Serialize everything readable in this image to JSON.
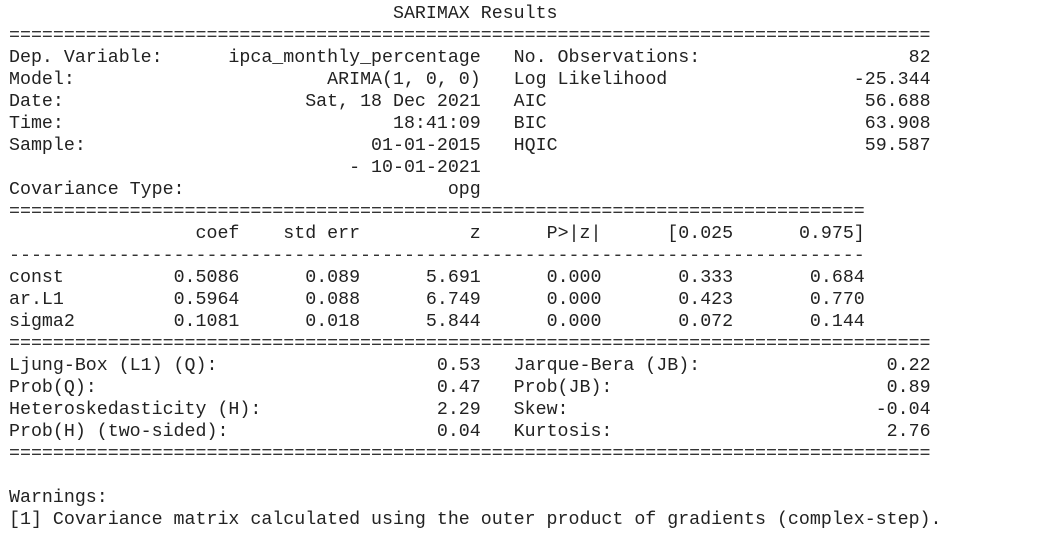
{
  "title": "SARIMAX Results",
  "header": {
    "left": [
      {
        "label": "Dep. Variable:",
        "value": "ipca_monthly_percentage"
      },
      {
        "label": "Model:",
        "value": "ARIMA(1, 0, 0)"
      },
      {
        "label": "Date:",
        "value": "Sat, 18 Dec 2021"
      },
      {
        "label": "Time:",
        "value": "18:41:09"
      },
      {
        "label": "Sample:",
        "value": "01-01-2015"
      },
      {
        "label": "",
        "value": "- 10-01-2021"
      },
      {
        "label": "Covariance Type:",
        "value": "opg"
      }
    ],
    "right": [
      {
        "label": "No. Observations:",
        "value": "82"
      },
      {
        "label": "Log Likelihood",
        "value": "-25.344"
      },
      {
        "label": "AIC",
        "value": "56.688"
      },
      {
        "label": "BIC",
        "value": "63.908"
      },
      {
        "label": "HQIC",
        "value": "59.587"
      }
    ]
  },
  "coef_table": {
    "columns": [
      "coef",
      "std err",
      "z",
      "P>|z|",
      "[0.025",
      "0.975]"
    ],
    "rows": [
      {
        "name": "const",
        "values": [
          "0.5086",
          "0.089",
          "5.691",
          "0.000",
          "0.333",
          "0.684"
        ]
      },
      {
        "name": "ar.L1",
        "values": [
          "0.5964",
          "0.088",
          "6.749",
          "0.000",
          "0.423",
          "0.770"
        ]
      },
      {
        "name": "sigma2",
        "values": [
          "0.1081",
          "0.018",
          "5.844",
          "0.000",
          "0.072",
          "0.144"
        ]
      }
    ]
  },
  "diagnostics": {
    "left": [
      {
        "label": "Ljung-Box (L1) (Q):",
        "value": "0.53"
      },
      {
        "label": "Prob(Q):",
        "value": "0.47"
      },
      {
        "label": "Heteroskedasticity (H):",
        "value": "2.29"
      },
      {
        "label": "Prob(H) (two-sided):",
        "value": "0.04"
      }
    ],
    "right": [
      {
        "label": "Jarque-Bera (JB):",
        "value": "0.22"
      },
      {
        "label": "Prob(JB):",
        "value": "0.89"
      },
      {
        "label": "Skew:",
        "value": "-0.04"
      },
      {
        "label": "Kurtosis:",
        "value": "2.76"
      }
    ]
  },
  "warnings": {
    "heading": "Warnings:",
    "items": [
      "[1] Covariance matrix calculated using the outer product of gradients (complex-step)."
    ]
  }
}
